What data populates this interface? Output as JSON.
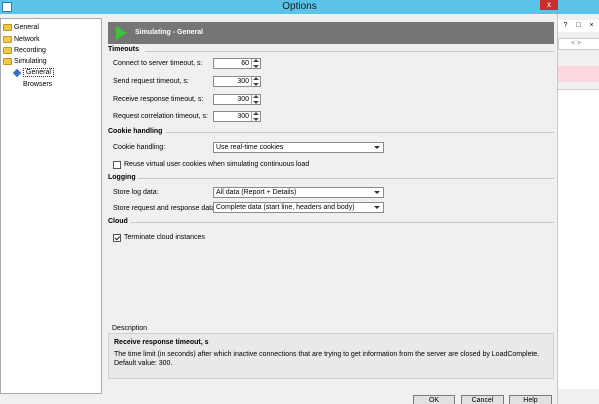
{
  "window": {
    "title": "Options",
    "close_glyph": "x"
  },
  "tree": [
    {
      "label": "General"
    },
    {
      "label": "Network"
    },
    {
      "label": "Recording"
    },
    {
      "label": "Simulating"
    },
    {
      "label": "General"
    },
    {
      "label": "Browsers"
    }
  ],
  "header": {
    "title": "Simulating - General"
  },
  "timeouts": {
    "heading": "Timeouts",
    "fields": [
      {
        "label": "Connect to server timeout, s:",
        "value": "60"
      },
      {
        "label": "Send request timeout, s:",
        "value": "300"
      },
      {
        "label": "Receive response timeout, s:",
        "value": "300"
      },
      {
        "label": "Request correlation timeout, s:",
        "value": "300"
      }
    ]
  },
  "cookies": {
    "heading": "Cookie handling",
    "label": "Cookie handling:",
    "value": "Use real-time cookies",
    "reuse_label": "Reuse virtual user cookies when simulating continuous load",
    "reuse_checked": false
  },
  "logging": {
    "heading": "Logging",
    "store_log_label": "Store log data:",
    "store_log_value": "All data (Report + Details)",
    "store_req_label": "Store request and response data:",
    "store_req_value": "Complete data (start line, headers and body)"
  },
  "cloud": {
    "heading": "Cloud",
    "terminate_label": "Terminate cloud instances",
    "terminate_checked": true
  },
  "description": {
    "title": "Description",
    "heading": "Receive response timeout, s",
    "text": "The time limit (in seconds) after which inactive connections that are trying to get information from the server are closed by LoadComplete. Default value: 300."
  },
  "buttons": {
    "ok": "OK",
    "cancel": "Cancel",
    "help": "Help"
  },
  "background_window": {
    "icon1": "?",
    "icon2": "□",
    "icon3": "×",
    "nav": "< >"
  },
  "colors": {
    "titlebar": "#5bc3e8",
    "header": "#757575",
    "play": "#3ec23e",
    "folder": "#f4c84a"
  }
}
